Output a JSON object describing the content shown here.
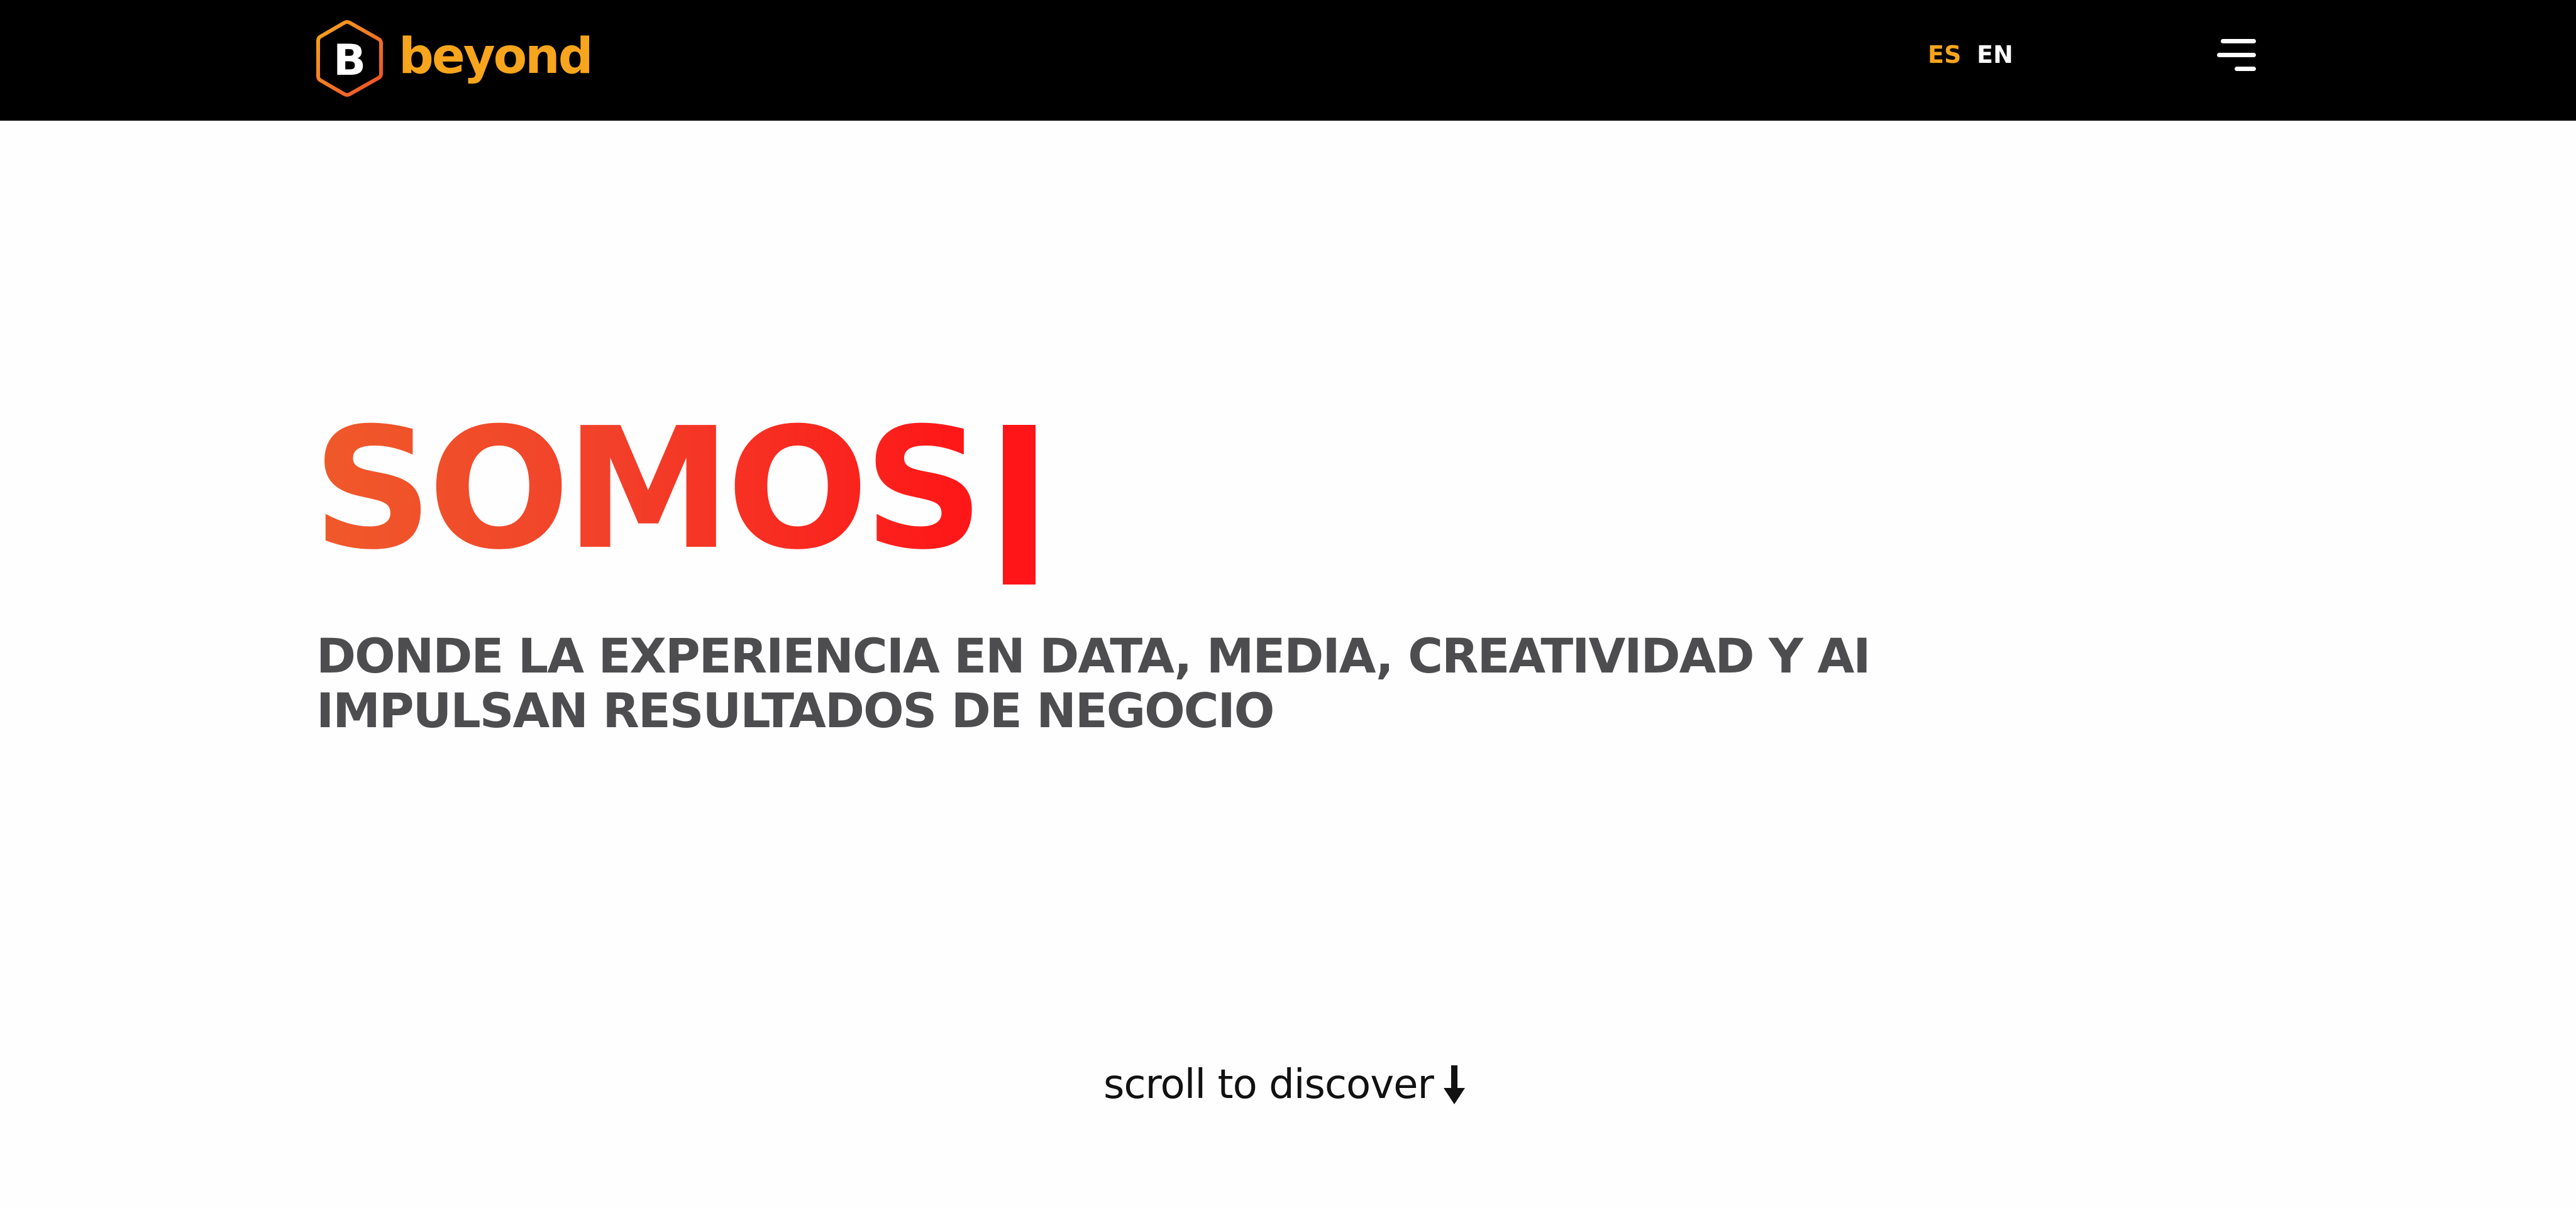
{
  "header": {
    "brand": {
      "name": "beyond",
      "mark_letter": "B",
      "icon": "hexagon-b-logo-icon",
      "color": "#f7a51d"
    },
    "languages": [
      {
        "label": "ES",
        "active": true,
        "color": "#f7a51d"
      },
      {
        "label": "EN",
        "active": false,
        "color": "#ffffff"
      }
    ],
    "menu_icon": "hamburger-menu-icon",
    "background": "#000000"
  },
  "hero": {
    "title": "SOMOS",
    "title_gradient": [
      "#ef5a2a",
      "#ff1517"
    ],
    "subtitle_lines": [
      "DONDE LA EXPERIENCIA EN DATA, MEDIA, CREATIVIDAD Y AI",
      "IMPULSAN RESULTADOS DE NEGOCIO"
    ],
    "subtitle_color": "#4d4d4f"
  },
  "scroll_cue": {
    "text": "scroll to discover",
    "icon": "arrow-down-icon"
  }
}
